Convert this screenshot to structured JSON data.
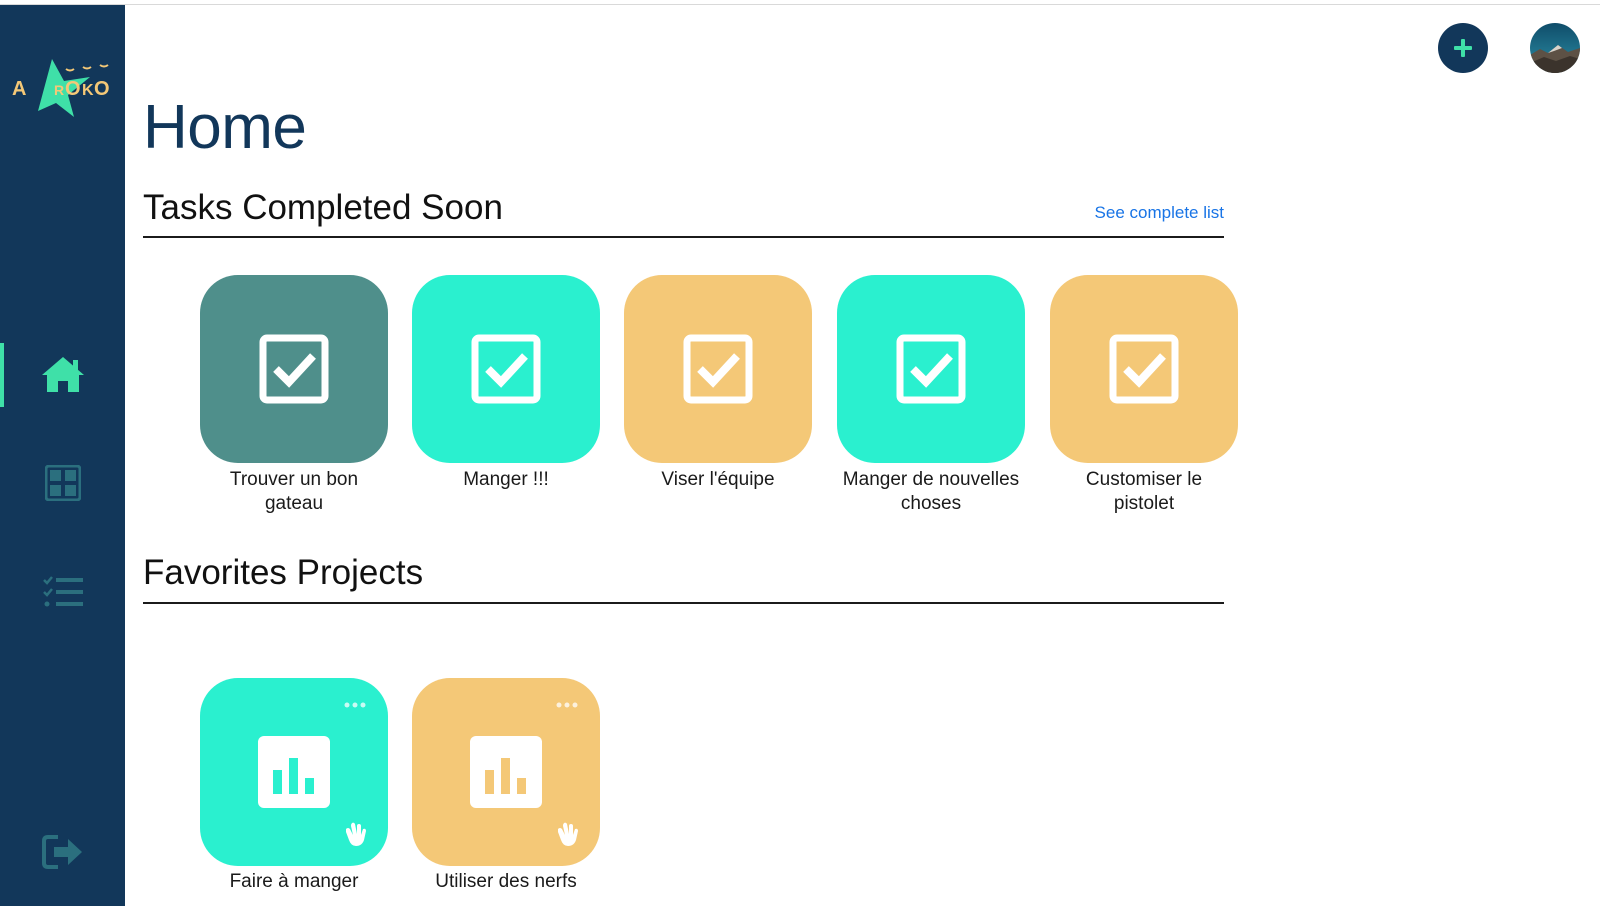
{
  "app": {
    "logo_text": "AKROKO"
  },
  "colors": {
    "sidebar": "#12375a",
    "accent": "#3fe0a8",
    "teal_dark": "#4f8f8b",
    "teal": "#2af0cf",
    "orange": "#f4c877",
    "link": "#1874e6"
  },
  "sidebar": {
    "items": [
      {
        "icon": "home-icon",
        "active": true
      },
      {
        "icon": "grid-icon",
        "active": false
      },
      {
        "icon": "checklist-icon",
        "active": false
      },
      {
        "icon": "logout-icon",
        "active": false
      }
    ]
  },
  "header": {
    "add_icon": "plus-icon",
    "avatar": "avatar"
  },
  "page": {
    "title": "Home"
  },
  "tasks_section": {
    "title": "Tasks Completed Soon",
    "link_label": "See complete list",
    "items": [
      {
        "line1": "Trouver un bon",
        "line2": "gateau",
        "color": "#4f8f8b",
        "icon": "checkbox-checked-icon"
      },
      {
        "line1": "Manger !!!",
        "line2": "",
        "color": "#2af0cf",
        "icon": "checkbox-checked-icon"
      },
      {
        "line1": "Viser l'équipe",
        "line2": "",
        "color": "#f4c877",
        "icon": "checkbox-checked-icon"
      },
      {
        "line1": "Manger de nouvelles",
        "line2": "choses",
        "color": "#2af0cf",
        "icon": "checkbox-checked-icon"
      },
      {
        "line1": "Customiser le",
        "line2": "pistolet",
        "color": "#f4c877",
        "icon": "checkbox-checked-icon"
      }
    ]
  },
  "projects_section": {
    "title": "Favorites Projects",
    "items": [
      {
        "label": "Faire à manger",
        "color": "#2af0cf",
        "icon": "bar-chart-icon"
      },
      {
        "label": "Utiliser des nerfs",
        "color": "#f4c877",
        "icon": "bar-chart-icon"
      }
    ]
  }
}
